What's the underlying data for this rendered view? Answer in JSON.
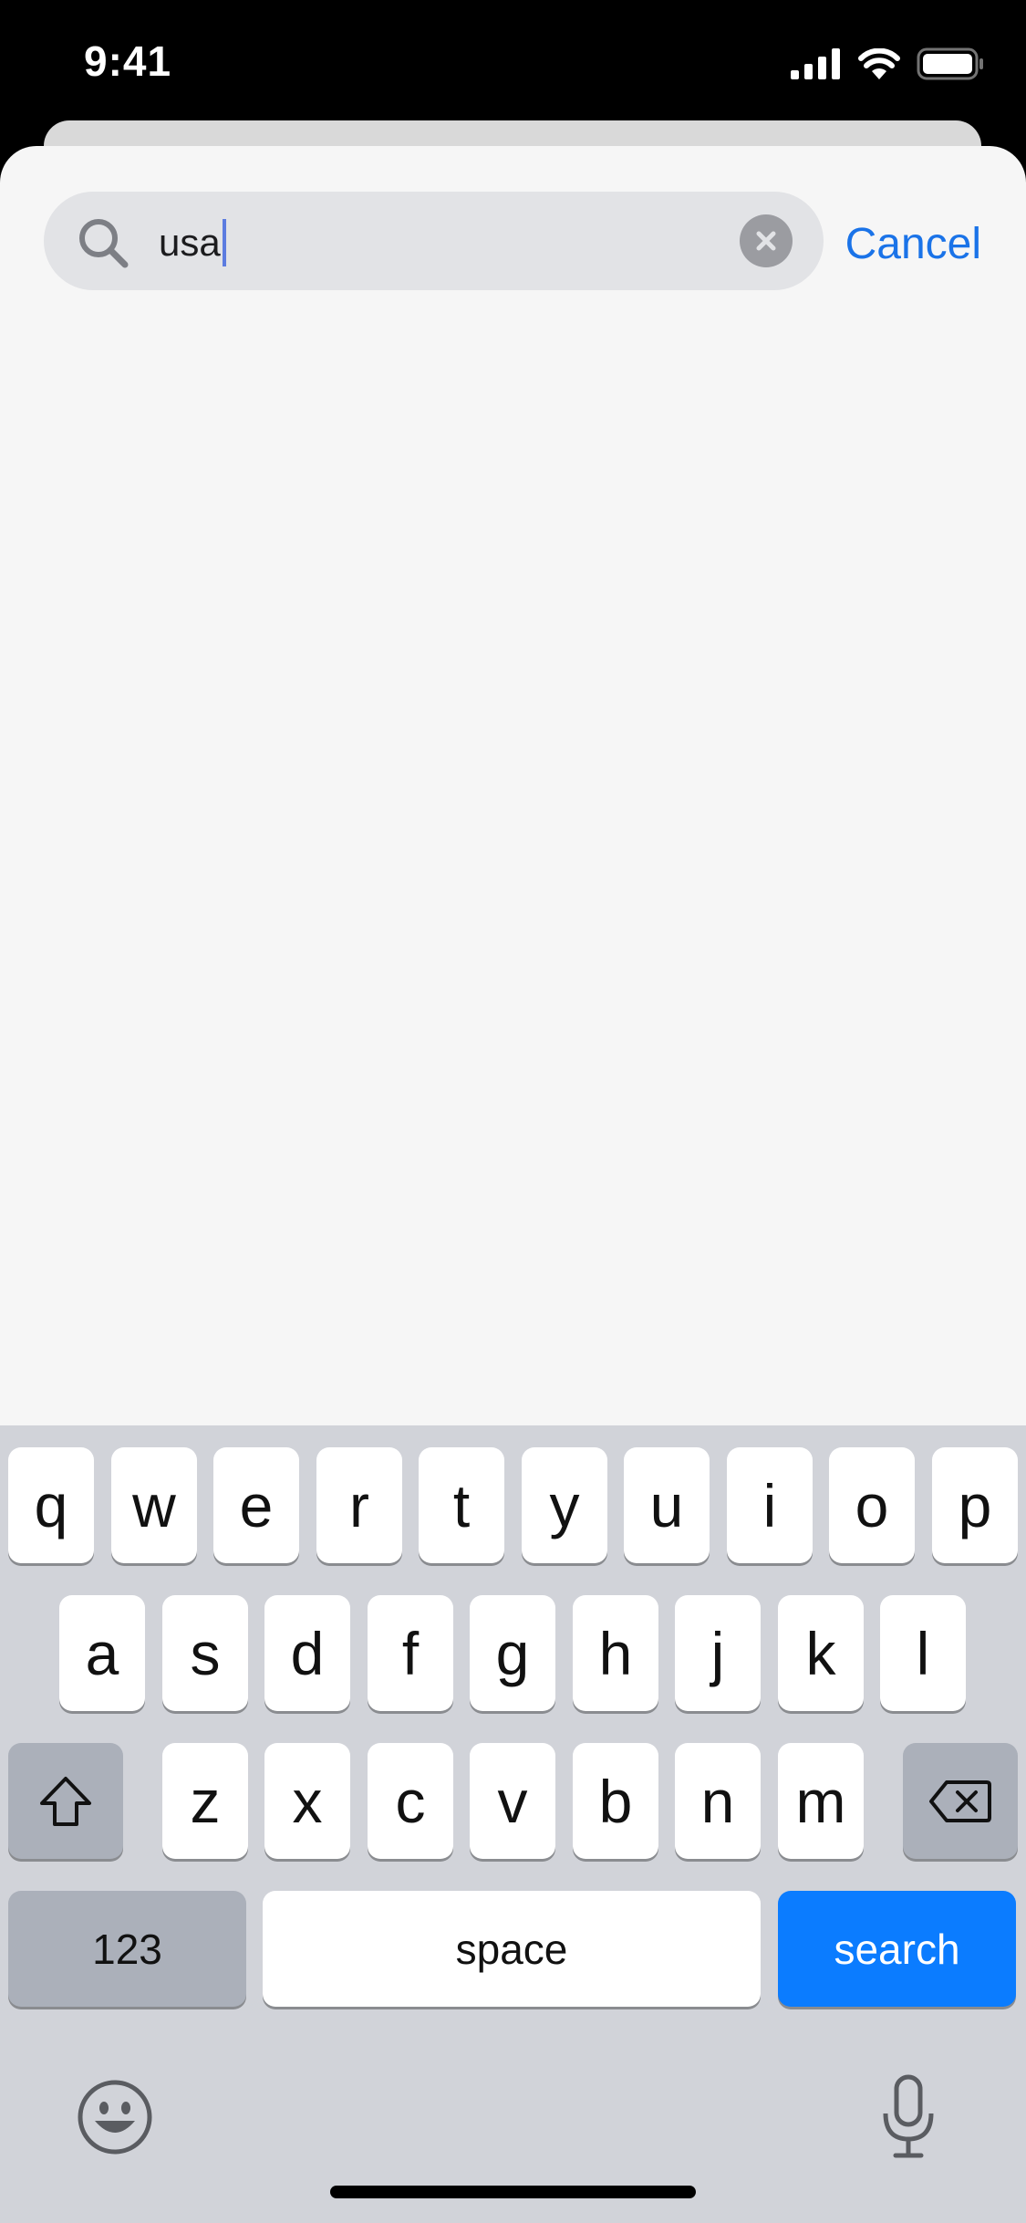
{
  "status_bar": {
    "time": "9:41"
  },
  "search": {
    "query": "usa"
  },
  "cancel_label": "Cancel",
  "keyboard": {
    "row1": [
      "q",
      "w",
      "e",
      "r",
      "t",
      "y",
      "u",
      "i",
      "o",
      "p"
    ],
    "row2": [
      "a",
      "s",
      "d",
      "f",
      "g",
      "h",
      "j",
      "k",
      "l"
    ],
    "row3": [
      "z",
      "x",
      "c",
      "v",
      "b",
      "n",
      "m"
    ],
    "numbers_label": "123",
    "space_label": "space",
    "search_label": "search"
  },
  "icons": [
    "signal-icon",
    "wifi-icon",
    "battery-icon",
    "search-icon",
    "clear-icon",
    "shift-icon",
    "delete-icon",
    "emoji-icon",
    "microphone-icon"
  ],
  "colors": {
    "accent": "#1a73e8",
    "search_key": "#0b7cff",
    "keyboard_bg": "#d1d3d9"
  }
}
